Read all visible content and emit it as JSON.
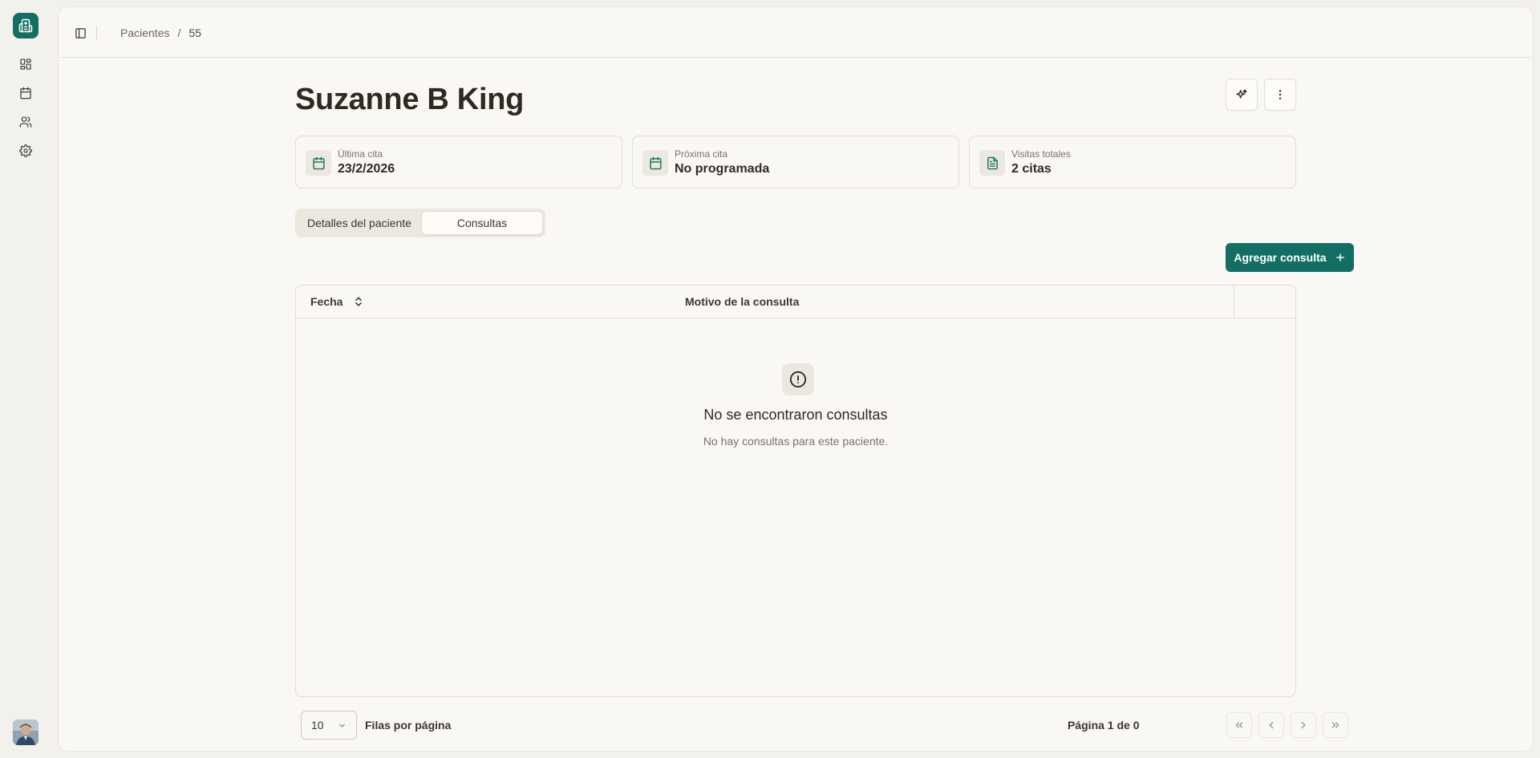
{
  "breadcrumb": {
    "parent": "Pacientes",
    "separator": "/",
    "current": "55"
  },
  "patient": {
    "name": "Suzanne B King"
  },
  "stats": [
    {
      "label": "Última cita",
      "value": "23/2/2026",
      "icon": "calendar-icon"
    },
    {
      "label": "Próxima cita",
      "value": "No programada",
      "icon": "calendar-icon"
    },
    {
      "label": "Visitas totales",
      "value": "2 citas",
      "icon": "document-icon"
    }
  ],
  "tabs": {
    "details": "Detalles del paciente",
    "consultations": "Consultas",
    "active": "consultations"
  },
  "actions": {
    "add_consultation": "Agregar consulta"
  },
  "table": {
    "columns": {
      "date": "Fecha",
      "reason": "Motivo de la consulta"
    },
    "empty_title": "No se encontraron consultas",
    "empty_description": "No hay consultas para este paciente."
  },
  "pagination": {
    "page_size": "10",
    "rows_label": "Filas por página",
    "page_info": "Página 1 de 0"
  },
  "colors": {
    "brand": "#136f63",
    "background": "#faf8f4",
    "border": "#e1ddd5"
  }
}
